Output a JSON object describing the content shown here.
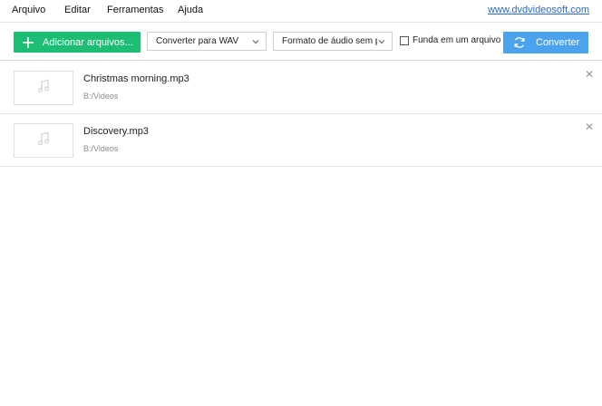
{
  "menu": {
    "items": [
      "Arquivo",
      "Editar",
      "Ferramentas",
      "Ajuda"
    ],
    "site_link": "www.dvdvideosoft.com"
  },
  "toolbar": {
    "add_label": "Adicionar arquivos...",
    "convert_to": "Converter para WAV",
    "format": "Formato de áudio sem perdas",
    "merge_label": "Funda em um arquivo",
    "merge_checked": false,
    "convert_label": "Converter",
    "accent_green": "#1dbe73",
    "accent_blue": "#4aa3ec"
  },
  "files": [
    {
      "name": "Christmas morning.mp3",
      "path": "B:/Videos"
    },
    {
      "name": "Discovery.mp3",
      "path": "B:/Videos"
    }
  ]
}
